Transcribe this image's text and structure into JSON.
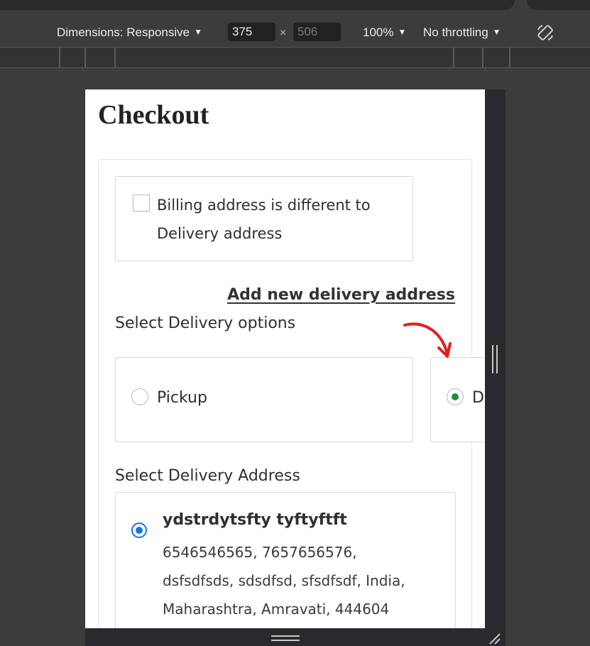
{
  "devtools": {
    "dimensions_label": "Dimensions: Responsive",
    "width_value": "375",
    "height_value": "506",
    "times_symbol": "×",
    "zoom_label": "100%",
    "throttle_label": "No throttling",
    "caret": "▼"
  },
  "page": {
    "title": "Checkout",
    "billing_checkbox_label": "Billing address is different to Delivery address",
    "add_address_link": "Add new delivery address",
    "delivery_options_heading": "Select Delivery options",
    "delivery_options": [
      {
        "label": "Pickup",
        "selected": false
      },
      {
        "label": "De",
        "selected": true
      }
    ],
    "delivery_address_heading": "Select Delivery Address",
    "address": {
      "name": "ydstrdytsfty tyftyftft",
      "phones": "6546546565, 7657656576,",
      "line2": "dsfsdfsds, sdsdfsd, sfsdfsdf, India,",
      "line3": "Maharashtra, Amravati, 444604"
    }
  },
  "colors": {
    "selected_option_dot": "#1e8e3e",
    "address_radio": "#1a73e8",
    "annotation_arrow": "#e02020"
  }
}
